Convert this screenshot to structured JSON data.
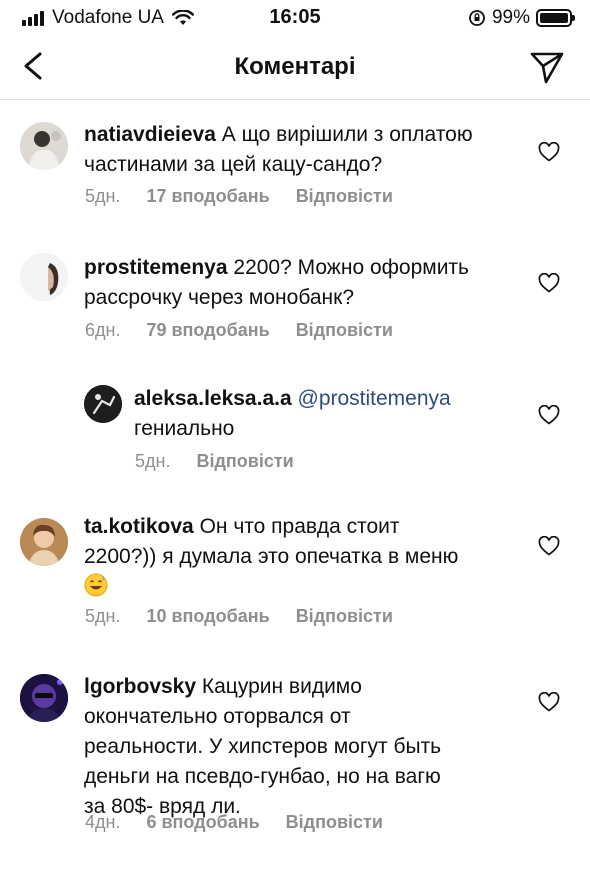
{
  "status_bar": {
    "carrier": "Vodafone UA",
    "time": "16:05",
    "battery": "99%",
    "battery_level": 0.99
  },
  "header": {
    "title": "Коментарі"
  },
  "comments": [
    {
      "username": "natiavdieieva",
      "text_1": "А що вирішили з оплатою",
      "text_2": "частинами за цей кацу-сандо?",
      "time": "5дн.",
      "likes": "17 вподобань",
      "reply": "Відповісти"
    },
    {
      "username": "prostitemenya",
      "text_1": "2200? Можно оформить",
      "text_2": "рассрочку через монобанк?",
      "time": "6дн.",
      "likes": "79 вподобань",
      "reply": "Відповісти"
    },
    {
      "username": "aleksa.leksa.a.a",
      "mention": "@prostitemenya",
      "text_2": "гениально",
      "time": "5дн.",
      "reply": "Відповісти"
    },
    {
      "username": "ta.kotikova",
      "text_1": "Он что правда стоит",
      "text_2": "2200?)) я думала это опечатка в меню",
      "emoji": "grinning-sweat-emoji",
      "time": "5дн.",
      "likes": "10 вподобань",
      "reply": "Відповісти"
    },
    {
      "username": "lgorbovsky",
      "text_1": "Кацурин видимо",
      "text_2": "окончательно оторвался от",
      "text_3": "реальности. У хипстеров могут быть",
      "text_4": "деньги на псевдо-гунбао, но на вагю",
      "text_5": "за 80$- вряд ли.",
      "time": "4дн.",
      "likes": "6 вподобань",
      "reply": "Відповісти"
    }
  ]
}
